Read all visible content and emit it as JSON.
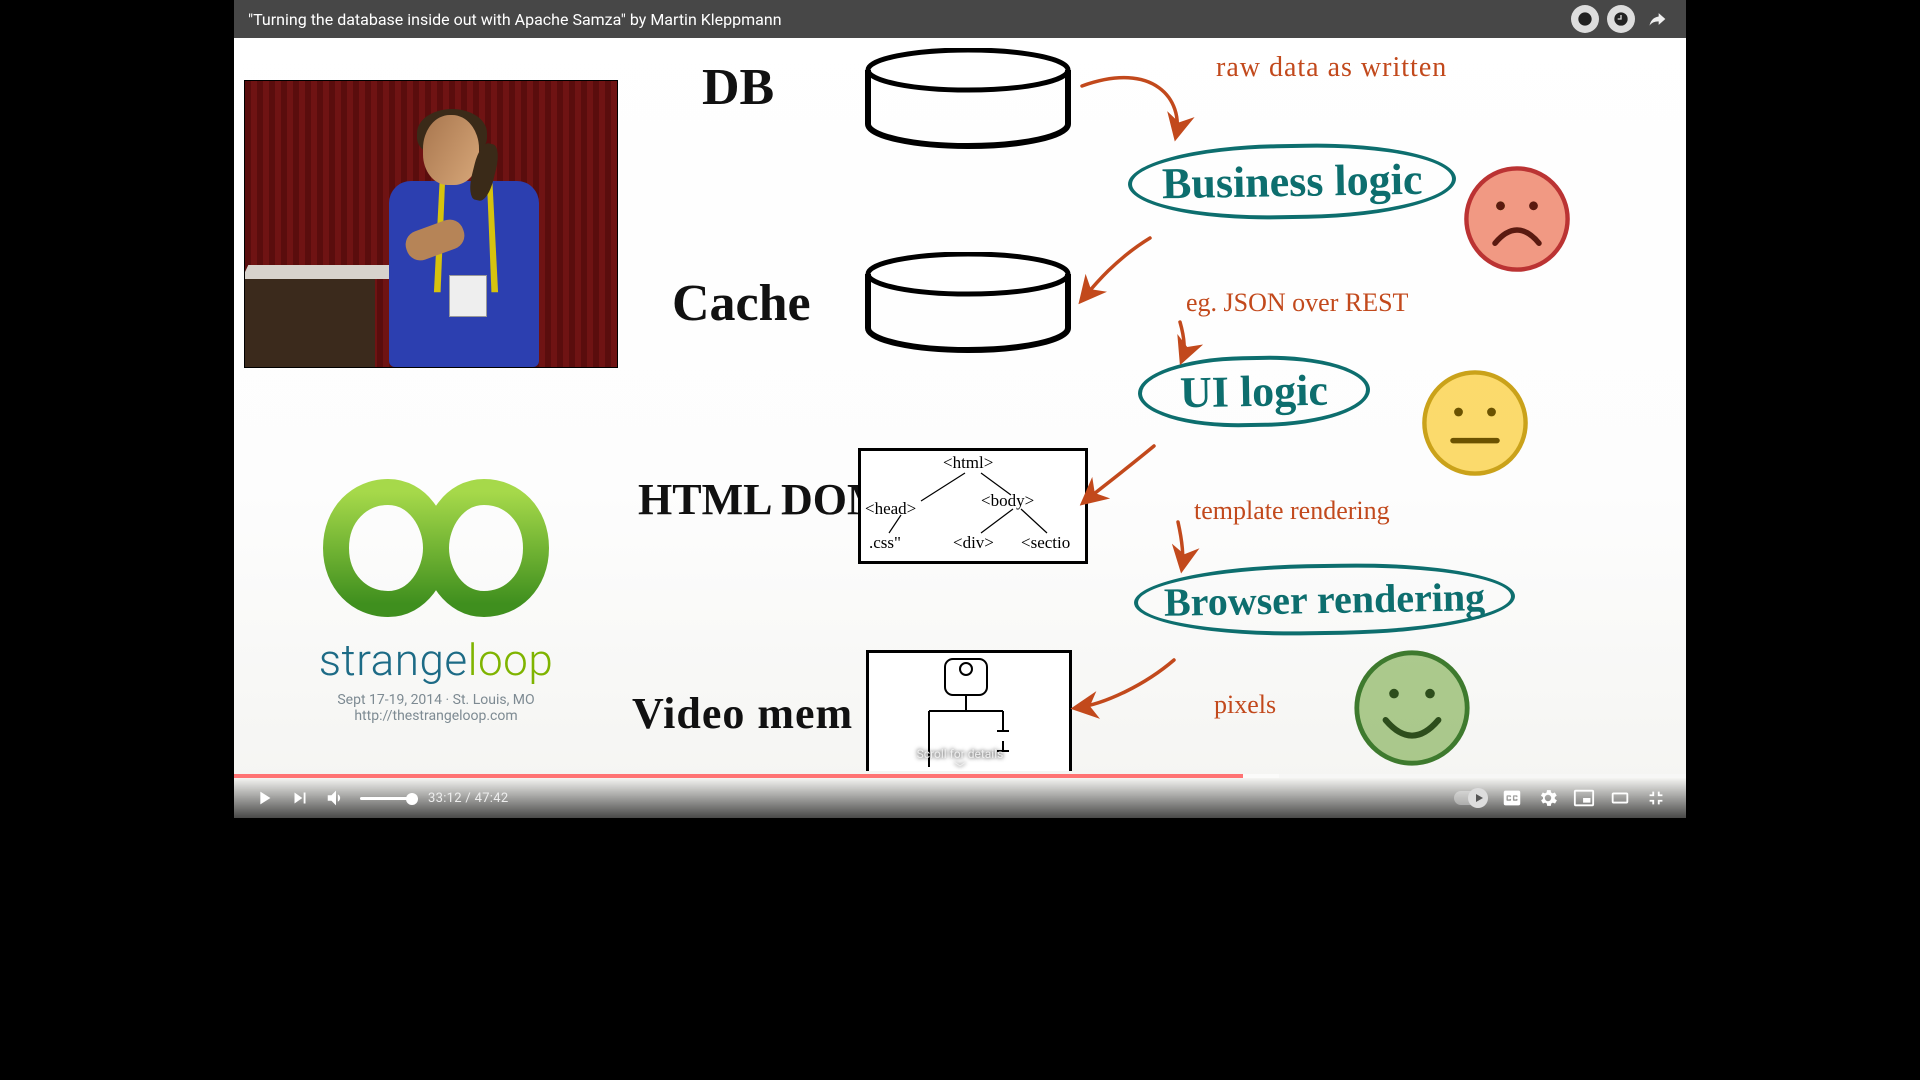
{
  "video": {
    "title": "\"Turning the database inside out with Apache Samza\" by Martin Kleppmann",
    "current_time": "33:12",
    "duration": "47:42",
    "scroll_hint": "Scroll for details",
    "progress_percent": 69.5,
    "buffered_percent": 72
  },
  "logo": {
    "name_a": "strange",
    "name_b": "loop",
    "dates": "Sept 17-19, 2014   ·   St. Louis, MO",
    "url": "http://thestrangeloop.com"
  },
  "diagram": {
    "levels": [
      {
        "key": "db",
        "label": "DB"
      },
      {
        "key": "cache",
        "label": "Cache"
      },
      {
        "key": "dom",
        "label": "HTML DOM"
      },
      {
        "key": "vmem",
        "label": "Video mem"
      }
    ],
    "bubbles": [
      {
        "key": "biz",
        "label": "Business logic"
      },
      {
        "key": "ui",
        "label": "UI logic"
      },
      {
        "key": "render",
        "label": "Browser rendering"
      }
    ],
    "annotations": {
      "raw": "raw data as written",
      "json": "eg.  JSON  over  REST",
      "tmpl": "template rendering",
      "pixels": "pixels"
    },
    "dom_nodes": {
      "html": "<html>",
      "head": "<head>",
      "body": "<body>",
      "css": ".css\"",
      "div": "<div>",
      "section": "<sectio"
    }
  }
}
